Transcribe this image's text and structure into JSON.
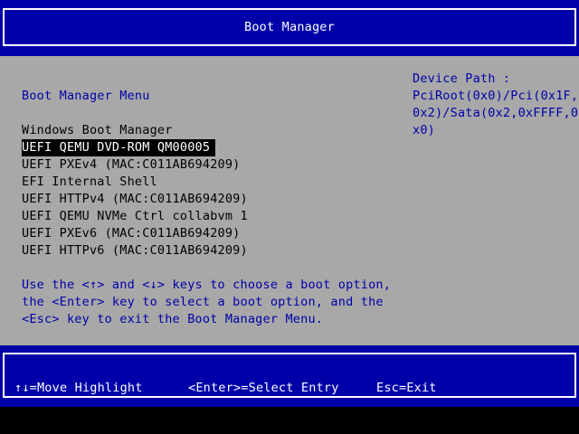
{
  "header": {
    "title": "Boot Manager"
  },
  "menu": {
    "heading": "Boot Manager Menu",
    "items": [
      {
        "label": "Windows Boot Manager"
      },
      {
        "label": "UEFI QEMU DVD-ROM QM00005",
        "selected": true
      },
      {
        "label": "UEFI PXEv4 (MAC:C011AB694209)"
      },
      {
        "label": "EFI Internal Shell"
      },
      {
        "label": "UEFI HTTPv4 (MAC:C011AB694209)"
      },
      {
        "label": "UEFI QEMU NVMe Ctrl collabvm 1"
      },
      {
        "label": "UEFI PXEv6 (MAC:C011AB694209)"
      },
      {
        "label": "UEFI HTTPv6 (MAC:C011AB694209)"
      }
    ]
  },
  "help": {
    "lines": [
      "Use the <↑> and <↓> keys to choose a boot option,",
      "the <Enter> key to select a boot option, and the",
      "<Esc> key to exit the Boot Manager Menu."
    ]
  },
  "device_path": {
    "label": "Device Path :",
    "lines": [
      "PciRoot(0x0)/Pci(0x1F,",
      "0x2)/Sata(0x2,0xFFFF,0",
      "x0)"
    ]
  },
  "footer": {
    "move": "↑↓=Move Highlight",
    "select": "<Enter>=Select Entry",
    "exit": "Esc=Exit"
  },
  "colors": {
    "background_blue": "#0000a8",
    "panel_gray": "#a8a8a8",
    "highlight": "#000000",
    "text_white": "#ffffff"
  }
}
